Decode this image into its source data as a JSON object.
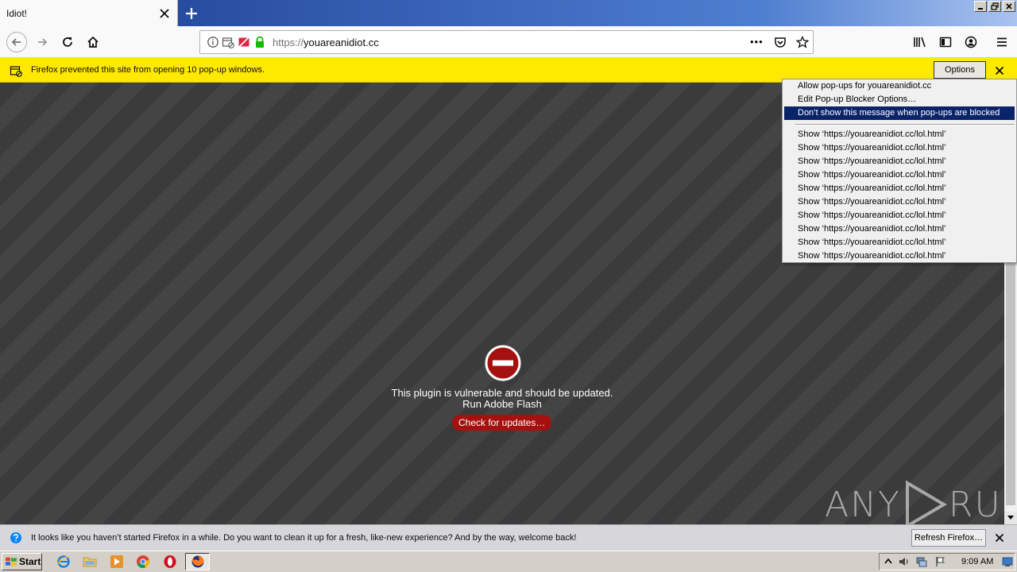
{
  "window": {
    "tab_title": "Idiot!",
    "minimize_label": "_",
    "maximize_label": "□",
    "close_label": "✕"
  },
  "navigation": {
    "url_scheme": "https://",
    "url_host": "youareanidiot.cc",
    "page_actions_label": "•••"
  },
  "popup_bar": {
    "message": "Firefox prevented this site from opening 10 pop-up windows.",
    "options_label": "Options"
  },
  "popup_menu": {
    "top_items": [
      "Allow pop-ups for youareanidiot.cc",
      "Edit Pop-up Blocker Options…",
      "Don’t show this message when pop-ups are blocked"
    ],
    "highlighted_index": 2,
    "show_items": [
      "Show ‘https://youareanidiot.cc/lol.html’",
      "Show ‘https://youareanidiot.cc/lol.html’",
      "Show ‘https://youareanidiot.cc/lol.html’",
      "Show ‘https://youareanidiot.cc/lol.html’",
      "Show ‘https://youareanidiot.cc/lol.html’",
      "Show ‘https://youareanidiot.cc/lol.html’",
      "Show ‘https://youareanidiot.cc/lol.html’",
      "Show ‘https://youareanidiot.cc/lol.html’",
      "Show ‘https://youareanidiot.cc/lol.html’",
      "Show ‘https://youareanidiot.cc/lol.html’"
    ]
  },
  "plugin": {
    "message": "This plugin is vulnerable and should be updated.",
    "plugin_name": "Run Adobe Flash",
    "button_label": "Check for updates…"
  },
  "watermark": {
    "left": "ANY",
    "right": "RUN"
  },
  "bottom_bar": {
    "message": "It looks like you haven’t started Firefox in a while. Do you want to clean it up for a fresh, like-new experience? And by the way, welcome back!",
    "button_label": "Refresh Firefox…"
  },
  "taskbar": {
    "start_label": "Start",
    "clock": "9:09 AM"
  },
  "colors": {
    "notification_yellow": "#ffe900",
    "menu_highlight": "#0a246a",
    "plugin_red": "#a4110f"
  }
}
